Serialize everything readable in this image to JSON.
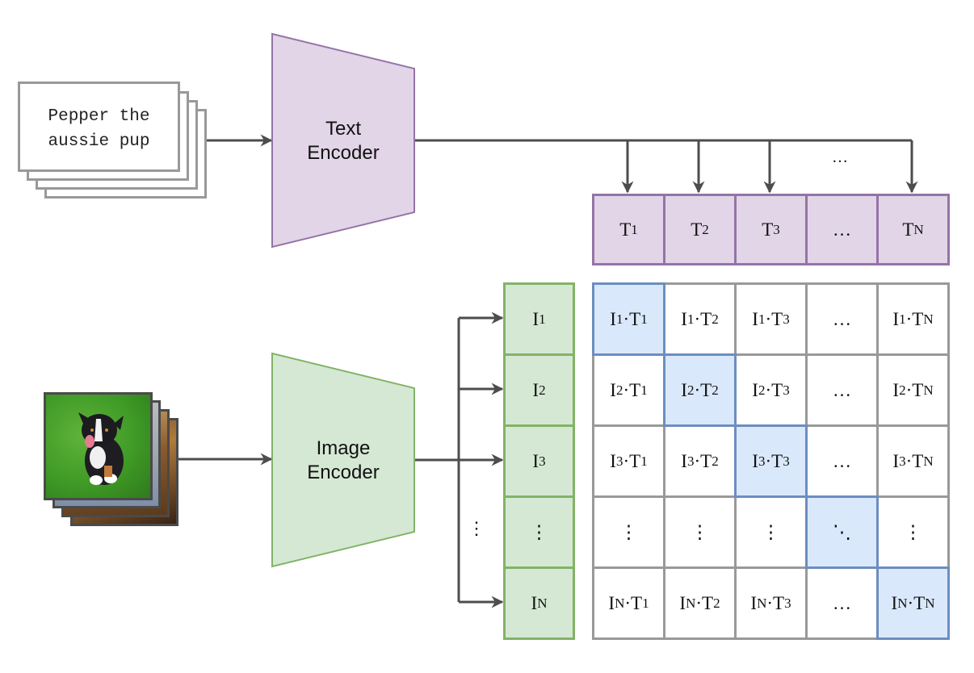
{
  "text_input": {
    "caption_lines": [
      "Pepper the",
      "aussie pup"
    ],
    "stack_count": 4
  },
  "image_input": {
    "description": "stack of photos, front photo shows a black, white and tan Australian Shepherd puppy sitting on green grass",
    "stack_count": 4
  },
  "text_encoder": {
    "label_line1": "Text",
    "label_line2": "Encoder",
    "fill": "#e1d5e7",
    "stroke": "#9673a6"
  },
  "image_encoder": {
    "label_line1": "Image",
    "label_line2": "Encoder",
    "fill": "#d5e8d4",
    "stroke": "#82b366"
  },
  "text_embeddings": [
    {
      "base": "T",
      "sub": "1"
    },
    {
      "base": "T",
      "sub": "2"
    },
    {
      "base": "T",
      "sub": "3"
    },
    {
      "base": "…",
      "sub": ""
    },
    {
      "base": "T",
      "sub": "N"
    }
  ],
  "text_arrows_ellipsis": "…",
  "image_embeddings": [
    {
      "base": "I",
      "sub": "1"
    },
    {
      "base": "I",
      "sub": "2"
    },
    {
      "base": "I",
      "sub": "3"
    },
    {
      "base": "⋮",
      "sub": ""
    },
    {
      "base": "I",
      "sub": "N"
    }
  ],
  "image_arrows_ellipsis": "⋮",
  "similarity_matrix": {
    "rows": [
      "1",
      "2",
      "3",
      "⋮",
      "N"
    ],
    "cols": [
      "1",
      "2",
      "3",
      "…",
      "N"
    ],
    "cells": [
      [
        "I1·T1",
        "I1·T2",
        "I1·T3",
        "…",
        "I1·TN"
      ],
      [
        "I2·T1",
        "I2·T2",
        "I2·T3",
        "…",
        "I2·TN"
      ],
      [
        "I3·T1",
        "I3·T2",
        "I3·T3",
        "…",
        "I3·TN"
      ],
      [
        "⋮",
        "⋮",
        "⋮",
        "⋱",
        "⋮"
      ],
      [
        "IN·T1",
        "IN·T2",
        "IN·T3",
        "…",
        "IN·TN"
      ]
    ],
    "diagonal_highlight": true,
    "diagonal_fill": "#dae8fc",
    "diagonal_stroke": "#6c8ebf"
  },
  "colors": {
    "arrow": "#4d4d4d",
    "grid_stroke": "#999999"
  }
}
